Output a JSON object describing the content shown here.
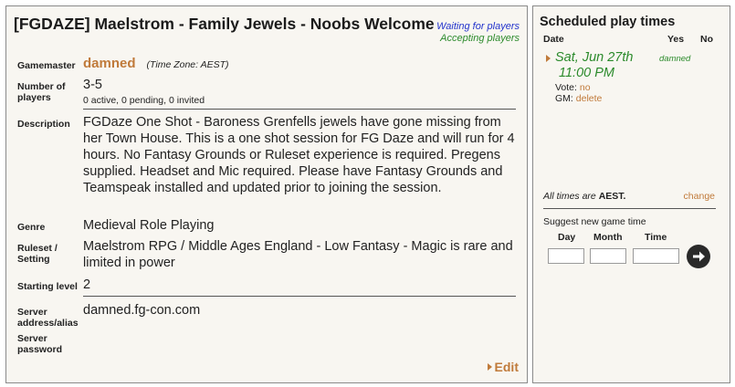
{
  "game": {
    "title": "[FGDAZE] Maelstrom - Family Jewels - Noobs Welcome",
    "status_waiting": "Waiting for players",
    "status_accepting": "Accepting players"
  },
  "details": {
    "gm_label": "Gamemaster",
    "gm_name": "damned",
    "gm_timezone": "(Time Zone: AEST)",
    "players_label": "Number of players",
    "players_count": "3-5",
    "players_sub": "0 active, 0 pending, 0 invited",
    "description_label": "Description",
    "description": "FGDaze One Shot - Baroness Grenfells jewels have gone missing from her Town House. This is a one shot session for FG Daze and will run for 4 hours. No Fantasy Grounds or Ruleset experience is required. Pregens supplied. Headset and Mic required. Please have Fantasy Grounds and Teamspeak installed and updated prior to joining the session.",
    "genre_label": "Genre",
    "genre": "Medieval Role Playing",
    "ruleset_label": "Ruleset / Setting",
    "ruleset": "Maelstrom RPG / Middle Ages England - Low Fantasy - Magic is rare and limited in power",
    "level_label": "Starting level",
    "level": "2",
    "server_label": "Server address/alias",
    "server": "damned.fg-con.com",
    "password_label": "Server password",
    "edit_label": "Edit"
  },
  "schedule": {
    "title": "Scheduled play times",
    "col_date": "Date",
    "col_yes": "Yes",
    "col_no": "No",
    "entry_date": "Sat, Jun 27th",
    "entry_time": "11:00 PM",
    "entry_gm": "damned",
    "vote_label": "Vote:",
    "vote_value": "no",
    "gm_label": "GM:",
    "gm_action": "delete",
    "tz_note_prefix": "All times are",
    "tz_note_zone": "AEST.",
    "change_label": "change",
    "suggest_label": "Suggest new game time",
    "col_day": "Day",
    "col_month": "Month",
    "col_time": "Time"
  }
}
